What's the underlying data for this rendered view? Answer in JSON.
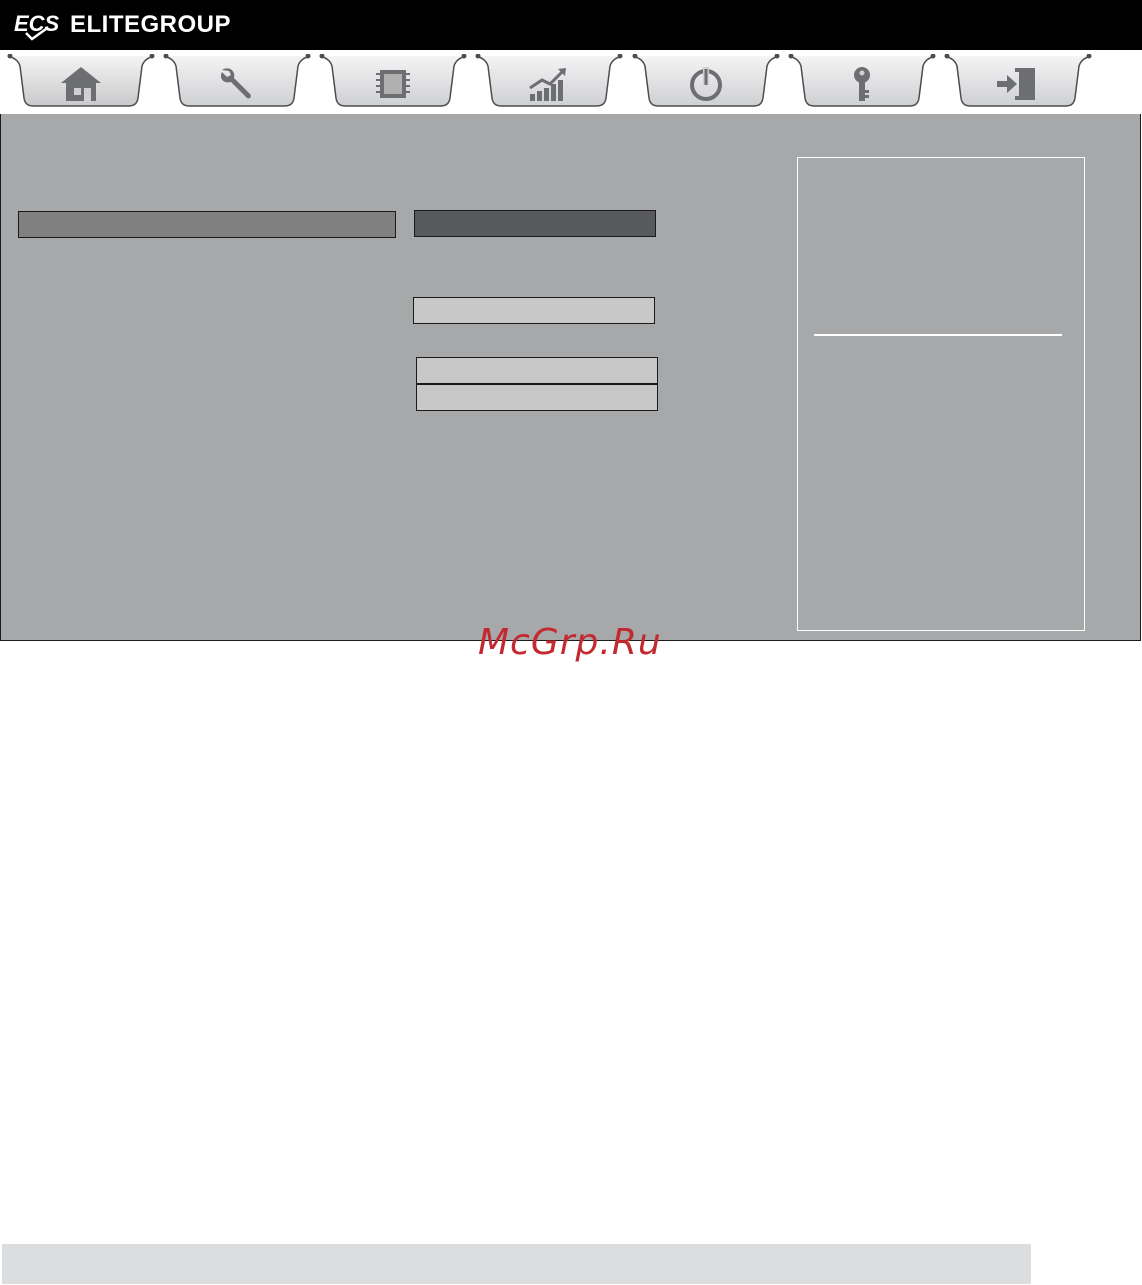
{
  "header": {
    "brand": "ELITEGROUP",
    "logo_text": "ECS",
    "background": "#000000"
  },
  "tabs": [
    {
      "name": "main",
      "icon": "home-icon"
    },
    {
      "name": "advanced",
      "icon": "wrench-icon"
    },
    {
      "name": "chipset",
      "icon": "chip-icon"
    },
    {
      "name": "performance",
      "icon": "chart-up-icon"
    },
    {
      "name": "power",
      "icon": "power-icon"
    },
    {
      "name": "security",
      "icon": "key-icon"
    },
    {
      "name": "exit",
      "icon": "exit-door-icon"
    }
  ],
  "colors": {
    "panel": "#a7a8aa",
    "bar_left": "#808080",
    "bar_right": "#58595b",
    "field": "#c8c8c8",
    "watermark": "#c22a30",
    "footer": "#dcdddf"
  },
  "watermark": "McGrp.Ru"
}
